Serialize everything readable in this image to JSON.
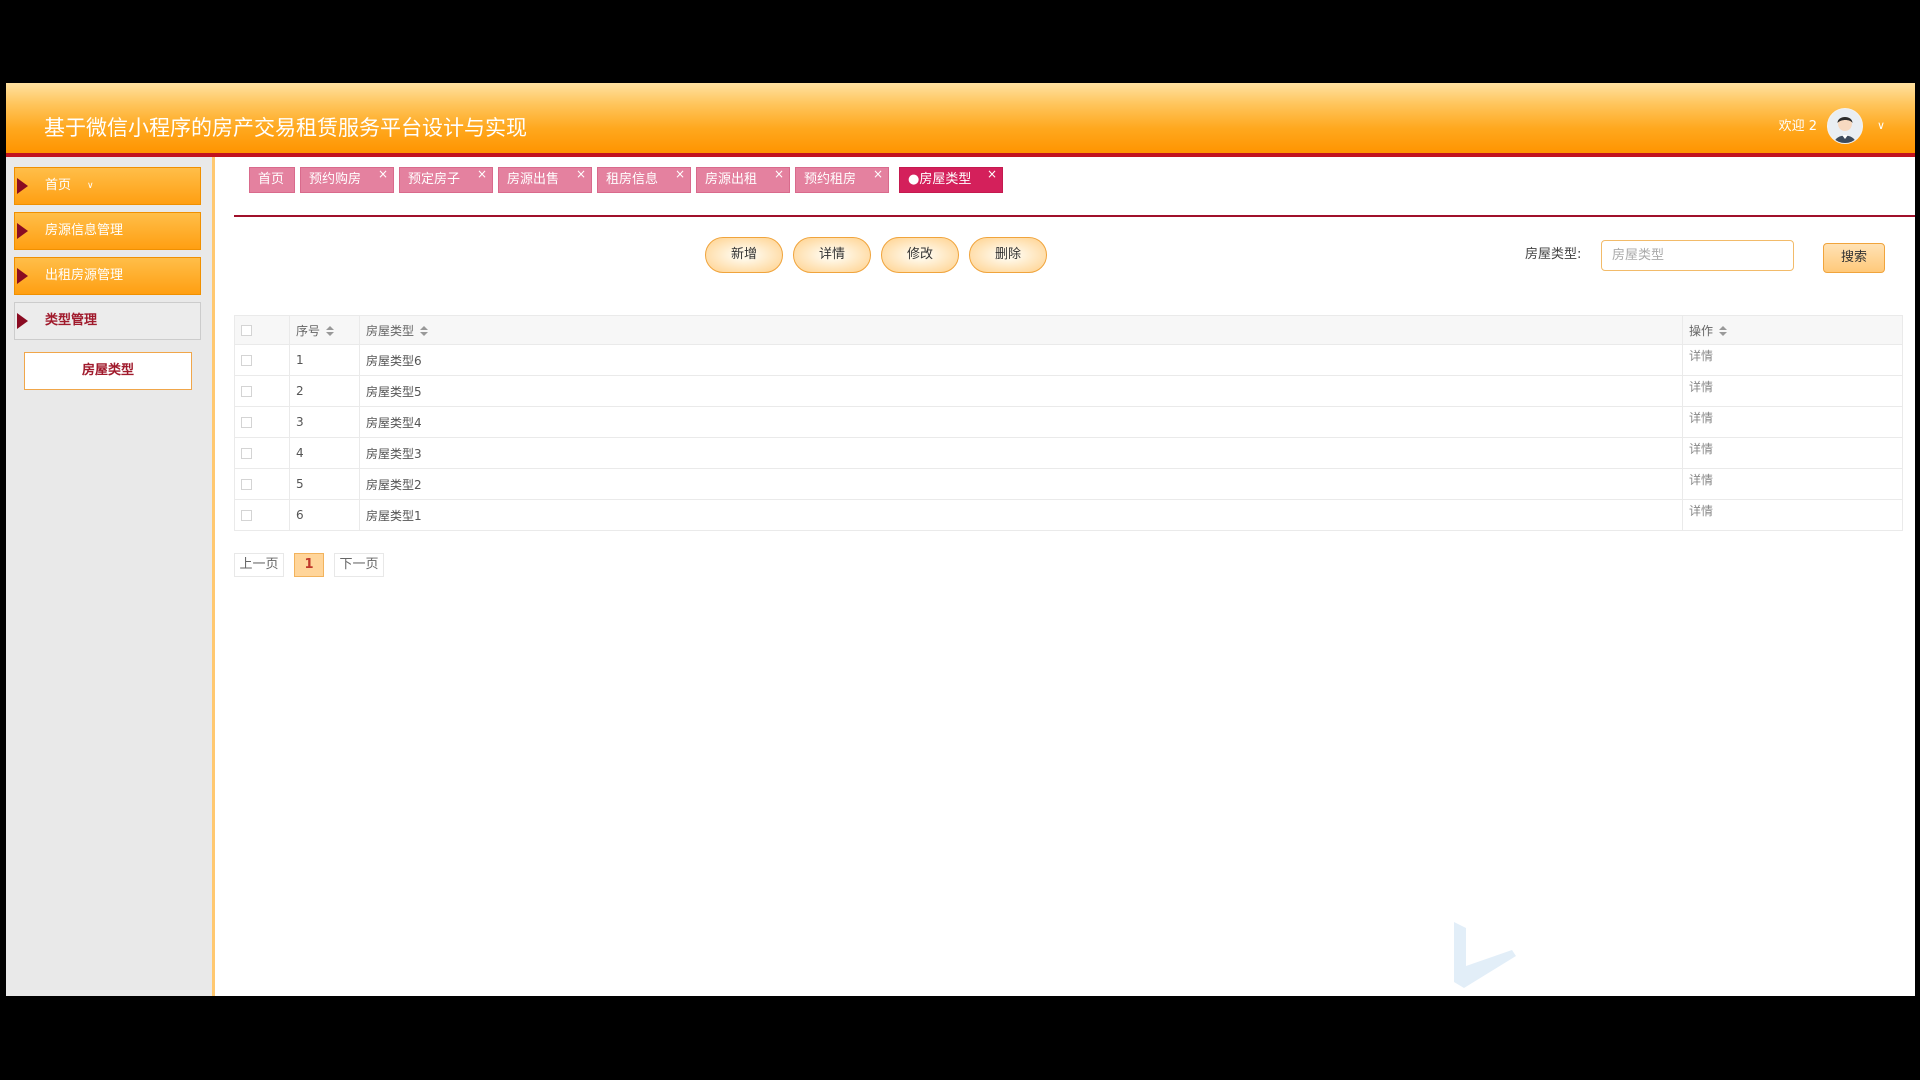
{
  "header": {
    "title": "基于微信小程序的房产交易租赁服务平台设计与实现",
    "welcome": "欢迎 2",
    "chevron": "∨"
  },
  "sidebar": {
    "items": [
      {
        "label": "首页",
        "chevron": "∨"
      },
      {
        "label": "房源信息管理"
      },
      {
        "label": "出租房源管理"
      },
      {
        "label": "类型管理"
      }
    ],
    "submenu": [
      {
        "label": "房屋类型"
      }
    ]
  },
  "tabs": [
    {
      "label": "首页"
    },
    {
      "label": "预约购房"
    },
    {
      "label": "预定房子"
    },
    {
      "label": "房源出售"
    },
    {
      "label": "租房信息"
    },
    {
      "label": "房源出租"
    },
    {
      "label": "预约租房"
    },
    {
      "label": "●房屋类型"
    }
  ],
  "tab_close": "×",
  "toolbar": {
    "add": "新增",
    "detail": "详情",
    "edit": "修改",
    "delete": "删除"
  },
  "search": {
    "label": "房屋类型:",
    "placeholder": "房屋类型",
    "button": "搜索"
  },
  "table": {
    "headers": {
      "index": "序号",
      "type": "房屋类型",
      "ops": "操作"
    },
    "rows": [
      {
        "index": "1",
        "type": "房屋类型6",
        "op": "详情"
      },
      {
        "index": "2",
        "type": "房屋类型5",
        "op": "详情"
      },
      {
        "index": "3",
        "type": "房屋类型4",
        "op": "详情"
      },
      {
        "index": "4",
        "type": "房屋类型3",
        "op": "详情"
      },
      {
        "index": "5",
        "type": "房屋类型2",
        "op": "详情"
      },
      {
        "index": "6",
        "type": "房屋类型1",
        "op": "详情"
      }
    ]
  },
  "pagination": {
    "prev": "上一页",
    "current": "1",
    "next": "下一页"
  },
  "colors": {
    "accent": "#ff9f12",
    "brand_red": "#a0102a",
    "tab_pink": "#e4819f",
    "tab_active": "#d4205b"
  },
  "icons": [
    "user-avatar-icon",
    "chevron-down-icon",
    "caret-right-icon",
    "close-icon",
    "sort-icon",
    "checkbox-icon",
    "watermark-logo"
  ]
}
